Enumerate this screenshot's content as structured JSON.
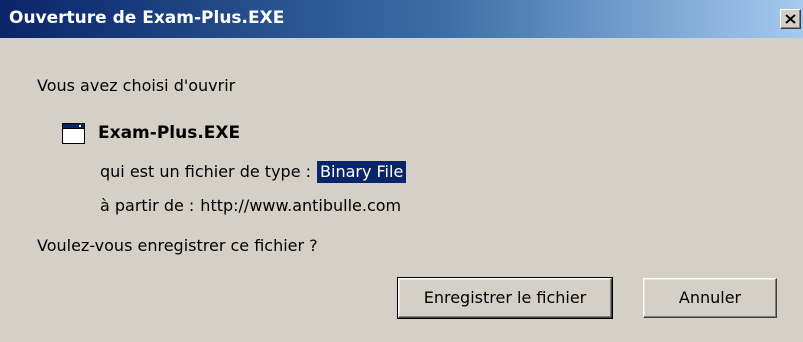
{
  "window": {
    "title": "Ouverture de Exam-Plus.EXE",
    "close_label": "×"
  },
  "dialog": {
    "intro": "Vous avez choisi d'ouvrir",
    "file_name": "Exam-Plus.EXE",
    "file_icon": "application-window-icon",
    "type_label": "qui est un fichier de type :",
    "type_value": "Binary File",
    "from_label": "à partir de :",
    "from_value": "http://www.antibulle.com",
    "question": "Voulez-vous enregistrer ce fichier ?"
  },
  "buttons": {
    "save_label": "Enregistrer le fichier",
    "cancel_label": "Annuler"
  },
  "colors": {
    "title_start": "#0A246A",
    "title_end": "#A6CAF0",
    "face": "#D4D0C8",
    "selection": "#0A246A"
  }
}
